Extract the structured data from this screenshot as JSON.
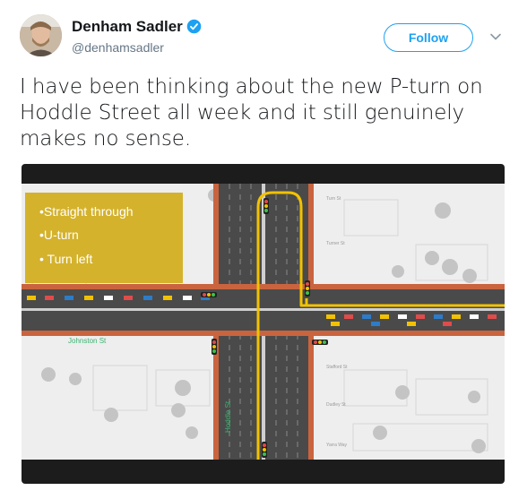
{
  "author": {
    "name": "Denham Sadler",
    "handle": "@denhamsadler",
    "verified": true
  },
  "follow_label": "Follow",
  "tweet_text": "I have been thinking about the new P-turn on Hoddle Street all week and it still genuinely makes no sense.",
  "media": {
    "legend": [
      "•Straight through",
      "•U-turn",
      "• Turn left"
    ],
    "street_labels": {
      "johnston": "Johnston St",
      "hoddle": "Hoddle St",
      "turn": "Turn St",
      "turner": "Turner St",
      "stafford": "Stafford St",
      "dudley": "Dudley St",
      "yarra": "Yarra Way"
    }
  },
  "colors": {
    "follow": "#1da1f2",
    "route": "#f2c200",
    "legend_bg": "#d4b22c",
    "road": "#4a4a4a",
    "footpath": "#c9643f"
  },
  "icons": [
    "verified-badge-icon",
    "chevron-down-icon"
  ]
}
